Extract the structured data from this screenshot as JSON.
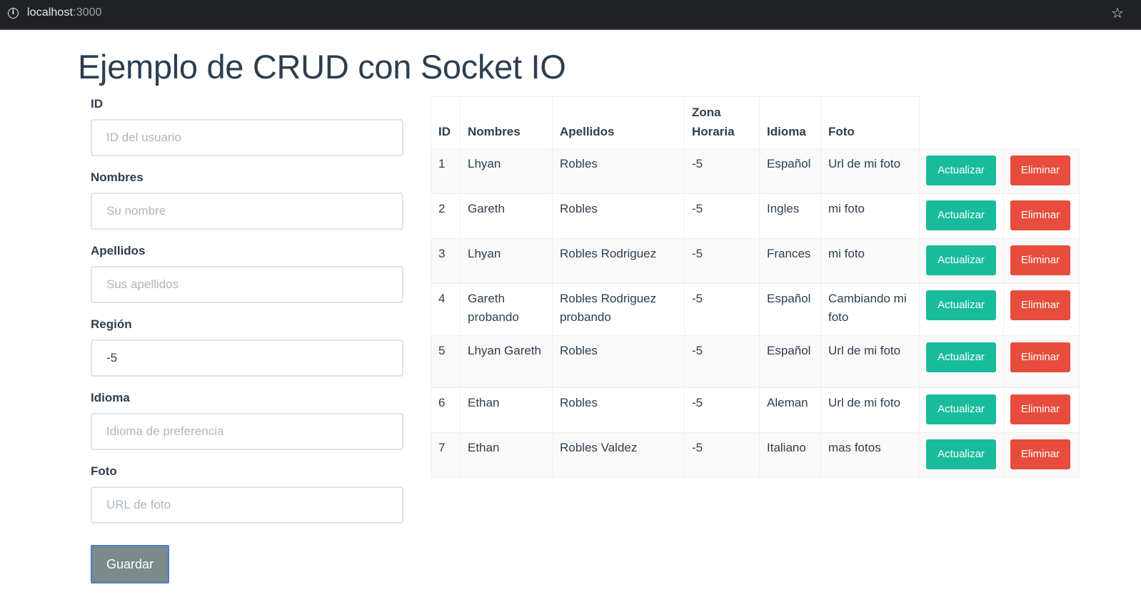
{
  "browser": {
    "url_host": "localhost",
    "url_port": ":3000"
  },
  "page": {
    "title": "Ejemplo de CRUD con Socket IO"
  },
  "form": {
    "fields": [
      {
        "label": "ID",
        "value": "",
        "placeholder": "ID del usuario"
      },
      {
        "label": "Nombres",
        "value": "",
        "placeholder": "Su nombre"
      },
      {
        "label": "Apellidos",
        "value": "",
        "placeholder": "Sus apellidos"
      },
      {
        "label": "Región",
        "value": "-5",
        "placeholder": ""
      },
      {
        "label": "Idioma",
        "value": "",
        "placeholder": "Idioma de preferencia"
      },
      {
        "label": "Foto",
        "value": "",
        "placeholder": "URL de foto"
      }
    ],
    "save_label": "Guardar"
  },
  "table": {
    "headers": [
      "ID",
      "Nombres",
      "Apellidos",
      "Zona Horaria",
      "Idioma",
      "Foto"
    ],
    "update_label": "Actualizar",
    "delete_label": "Eliminar",
    "rows": [
      {
        "id": "1",
        "nombres": "Lhyan",
        "apellidos": "Robles",
        "zona": "-5",
        "idioma": "Español",
        "foto": "Url de mi foto"
      },
      {
        "id": "2",
        "nombres": "Gareth",
        "apellidos": "Robles",
        "zona": "-5",
        "idioma": "Ingles",
        "foto": "mi foto"
      },
      {
        "id": "3",
        "nombres": "Lhyan",
        "apellidos": "Robles Rodriguez",
        "zona": "-5",
        "idioma": "Frances",
        "foto": "mi foto"
      },
      {
        "id": "4",
        "nombres": "Gareth probando",
        "apellidos": "Robles Rodriguez probando",
        "zona": "-5",
        "idioma": "Español",
        "foto": "Cambiando mi foto"
      },
      {
        "id": "5",
        "nombres": "Lhyan Gareth",
        "apellidos": "Robles",
        "zona": "-5",
        "idioma": "Español",
        "foto": "Url de mi foto"
      },
      {
        "id": "6",
        "nombres": "Ethan",
        "apellidos": "Robles",
        "zona": "-5",
        "idioma": "Aleman",
        "foto": "Url de mi foto"
      },
      {
        "id": "7",
        "nombres": "Ethan",
        "apellidos": "Robles Valdez",
        "zona": "-5",
        "idioma": "Italiano",
        "foto": "mas fotos"
      }
    ]
  },
  "colors": {
    "primary_text": "#2c3e50",
    "success": "#18bc9c",
    "danger": "#e74c3c",
    "save_button": "#7b8a8b",
    "input_border": "#dce4ec"
  },
  "icons": {
    "site_info": "info-icon",
    "bookmark": "star-icon"
  }
}
